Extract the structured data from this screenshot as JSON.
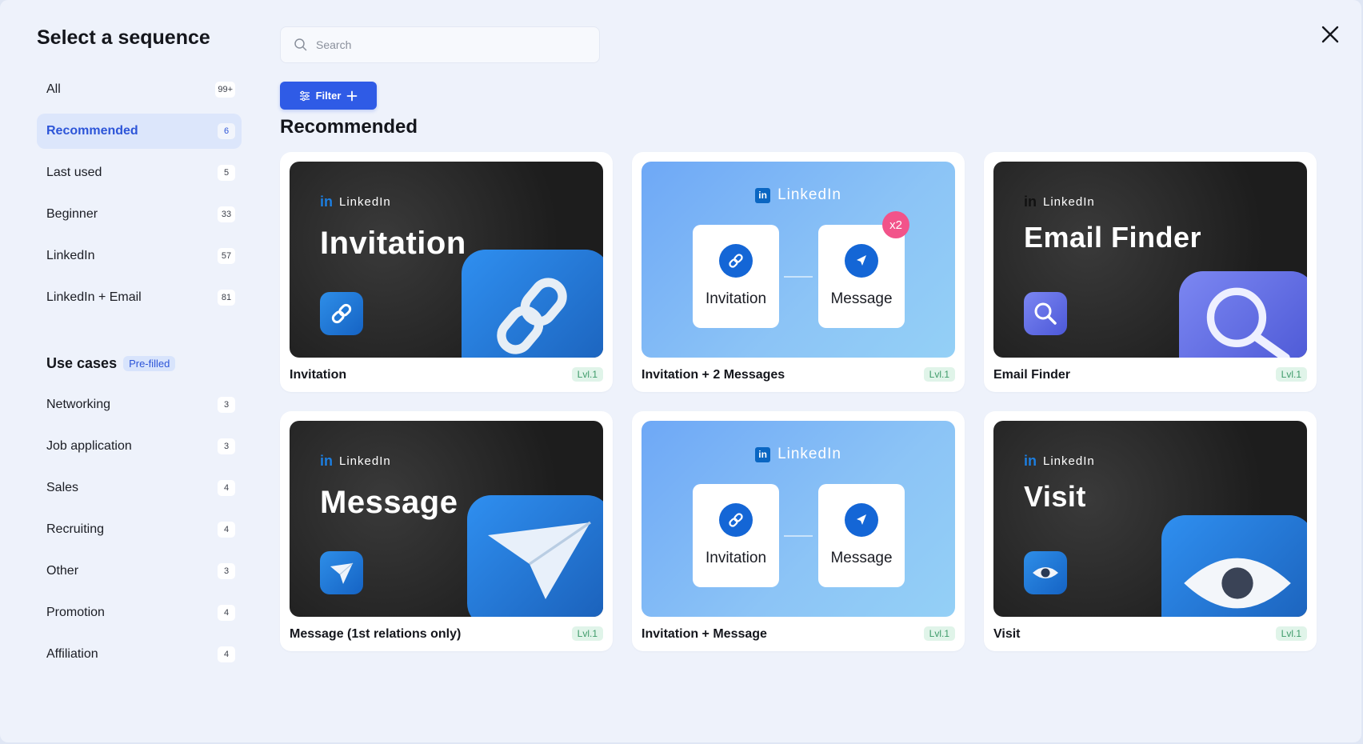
{
  "modal": {
    "title": "Select a sequence"
  },
  "search": {
    "placeholder": "Search"
  },
  "filter": {
    "label": "Filter"
  },
  "section_title": "Recommended",
  "sidebar": {
    "items": [
      {
        "label": "All",
        "count": "99+",
        "active": false
      },
      {
        "label": "Recommended",
        "count": "6",
        "active": true
      },
      {
        "label": "Last used",
        "count": "5",
        "active": false
      },
      {
        "label": "Beginner",
        "count": "33",
        "active": false
      },
      {
        "label": "LinkedIn",
        "count": "57",
        "active": false
      },
      {
        "label": "LinkedIn + Email",
        "count": "81",
        "active": false
      }
    ],
    "usecases": {
      "title": "Use cases",
      "badge": "Pre-filled",
      "items": [
        {
          "label": "Networking",
          "count": "3"
        },
        {
          "label": "Job application",
          "count": "3"
        },
        {
          "label": "Sales",
          "count": "4"
        },
        {
          "label": "Recruiting",
          "count": "4"
        },
        {
          "label": "Other",
          "count": "3"
        },
        {
          "label": "Promotion",
          "count": "4"
        },
        {
          "label": "Affiliation",
          "count": "4"
        }
      ]
    }
  },
  "cards": [
    {
      "name": "Invitation",
      "level": "Lvl.1",
      "brand_in": "in",
      "brand": "LinkedIn",
      "thumb_title": "Invitation",
      "icon": "link-icon"
    },
    {
      "name": "Invitation + 2 Messages",
      "level": "Lvl.1",
      "brand_in": "in",
      "brand": "LinkedIn",
      "step1": "Invitation",
      "step2": "Message",
      "badge": "x2"
    },
    {
      "name": "Email Finder",
      "level": "Lvl.1",
      "brand_in": "in",
      "brand": "LinkedIn",
      "thumb_title": "Email Finder",
      "icon": "magnifier-icon"
    },
    {
      "name": "Message (1st relations only)",
      "level": "Lvl.1",
      "brand_in": "in",
      "brand": "LinkedIn",
      "thumb_title": "Message",
      "icon": "paper-plane-icon"
    },
    {
      "name": "Invitation + Message",
      "level": "Lvl.1",
      "brand_in": "in",
      "brand": "LinkedIn",
      "step1": "Invitation",
      "step2": "Message"
    },
    {
      "name": "Visit",
      "level": "Lvl.1",
      "brand_in": "in",
      "brand": "LinkedIn",
      "thumb_title": "Visit",
      "icon": "eye-icon"
    }
  ],
  "colors": {
    "accent": "#2f5be6",
    "linkedin_blue": "#1466d6",
    "badge_pink": "#f2538a",
    "level_green": "#3e9b6a"
  }
}
